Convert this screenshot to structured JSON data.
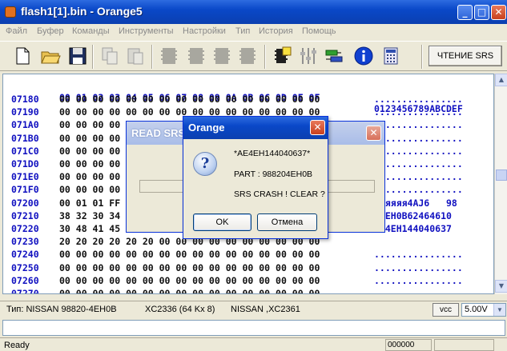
{
  "window": {
    "title": "flash1[1].bin - Orange5"
  },
  "menu": [
    "Файл",
    "Буфер",
    "Команды",
    "Инструменты",
    "Настройки",
    "Тип",
    "История",
    "Помощь"
  ],
  "toolbar": {
    "icons": [
      "new-file-icon",
      "open-folder-icon",
      "save-disk-icon",
      "copy-icon",
      "paste-icon",
      "chip-icon",
      "chip-icon",
      "chip-icon",
      "chip-icon",
      "chip-icon",
      "chip-check-icon",
      "sliders-icon",
      "connector-icon",
      "info-icon",
      "calculator-icon"
    ],
    "srs_button": "ЧТЕНИЕ SRS"
  },
  "hex": {
    "header_bytes": "00 01 02 03 04 05 06 07 08 09 0A 0B 0C 0D 0E 0F",
    "header_ascii": "0123456789ABCDEF",
    "rows": [
      {
        "addr": "07180",
        "bytes": "00 00 00 00 00 00 00 00 00 00 00 00 00 00 00 00",
        "ascii": "................"
      },
      {
        "addr": "07190",
        "bytes": "00 00 00 00 00 00 00 00 00 00 00 00 00 00 00 00",
        "ascii": "................"
      },
      {
        "addr": "071A0",
        "bytes": "00 00 00 00 00 00 00 00 00 00 00 00 00 00 00 00",
        "ascii": "................"
      },
      {
        "addr": "071B0",
        "bytes": "00 00 00 00 00 00 00 00 00 00 00 00 00 00 00 00",
        "ascii": "................"
      },
      {
        "addr": "071C0",
        "bytes": "00 00 00 00 00 00 00 00 00 00 00 00 00 00 00 00",
        "ascii": "................"
      },
      {
        "addr": "071D0",
        "bytes": "00 00 00 00 00 00 00 00 00 00 00 00 00 00 00 00",
        "ascii": "................"
      },
      {
        "addr": "071E0",
        "bytes": "00 00 00 00 00 00 00 00 00 00 00 00 00 00 00 00",
        "ascii": "................"
      },
      {
        "addr": "071F0",
        "bytes": "00 00 00 00 00 00 00 00 00 00 00 00 00 00 00 00",
        "ascii": "................"
      },
      {
        "addr": "07200",
        "bytes": "00 01 01 FF 00 00 00 00 00 00 00 00 00 00 00 00",
        "ascii": ".яяяяя4AJ6   98"
      },
      {
        "addr": "07210",
        "bytes": "38 32 30 34 00 00 00 00 00 00 00 00 00 00 00 00",
        "ascii": "04EH0B62464610"
      },
      {
        "addr": "07220",
        "bytes": "30 48 41 45 00 00 00 00 00 00 00 00 00 00 00 00",
        "ascii": "AE4EH144040637"
      },
      {
        "addr": "07230",
        "bytes": "20 20 20 20 20 20 00 00 00 00 00 00 00 00 00 00",
        "ascii": ""
      },
      {
        "addr": "07240",
        "bytes": "00 00 00 00 00 00 00 00 00 00 00 00 00 00 00 00",
        "ascii": "................"
      },
      {
        "addr": "07250",
        "bytes": "00 00 00 00 00 00 00 00 00 00 00 00 00 00 00 00",
        "ascii": "................"
      },
      {
        "addr": "07260",
        "bytes": "00 00 00 00 00 00 00 00 00 00 00 00 00 00 00 00",
        "ascii": "................"
      },
      {
        "addr": "07270",
        "bytes": "00 00 00 00 00 00 00 00 00 00 00 00 00 00 00 00",
        "ascii": "................"
      }
    ]
  },
  "info": {
    "type_label": "Тип: NISSAN 98820-4EH0B",
    "chip": "XC2336 (64 Kx 8)",
    "chip2": "NISSAN ,XC2361",
    "vcc_button": "vcc",
    "voltage": "5.00V"
  },
  "status": {
    "ready": "Ready",
    "position": "000000"
  },
  "dialog_read": {
    "title": "READ SRS"
  },
  "dialog_msg": {
    "title": "Orange",
    "line1": "*AE4EH144040637*",
    "line2": "PART :  988204EH0B",
    "line3": "SRS CRASH ! CLEAR ?",
    "ok": "OK",
    "cancel": "Отмена"
  },
  "icons": {
    "question": "question-icon",
    "close": "close-icon"
  }
}
